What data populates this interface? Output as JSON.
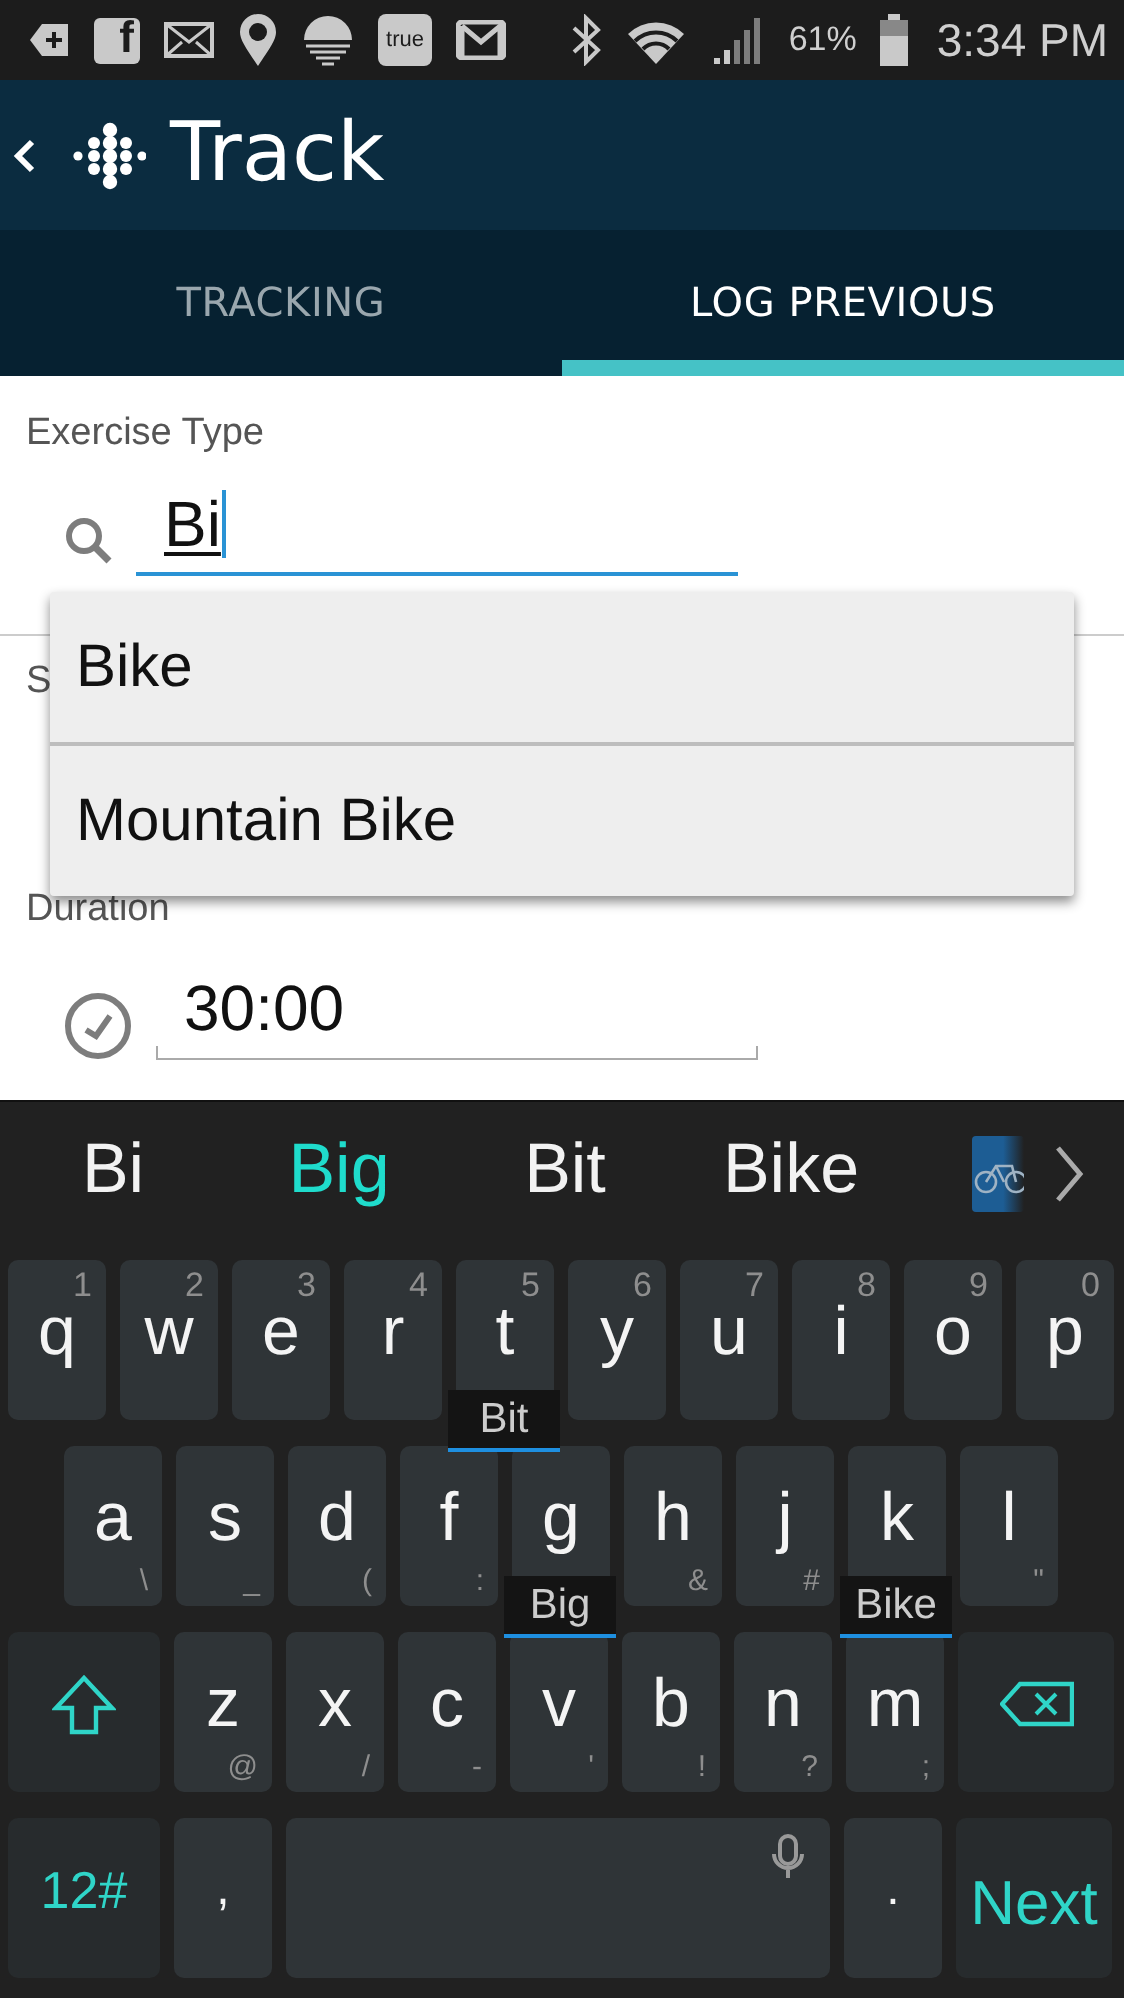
{
  "status_bar": {
    "app_badge": "f",
    "carrier_badge": "true",
    "battery": "61%",
    "time": "3:34 PM"
  },
  "app_bar": {
    "title": "Track"
  },
  "tabs": [
    {
      "label": "TRACKING",
      "selected": false
    },
    {
      "label": "LOG PREVIOUS",
      "selected": true
    }
  ],
  "form": {
    "fields": [
      {
        "kind": "search",
        "label": "Exercise Type",
        "value": "Bi",
        "focused": true
      },
      {
        "kind": "label_only",
        "label": "S"
      },
      {
        "kind": "duration",
        "label": "Duration",
        "value": "30:00",
        "focused": false
      }
    ],
    "dropdown": [
      "Bike",
      "Mountain Bike"
    ]
  },
  "keyboard": {
    "suggestions": [
      {
        "text": "Bi",
        "selected": false
      },
      {
        "text": "Big",
        "selected": true
      },
      {
        "text": "Bit",
        "selected": false
      },
      {
        "text": "Bike",
        "selected": false
      }
    ],
    "rows": [
      {
        "keys": [
          {
            "kind": "letter",
            "label": "q",
            "hint": "1"
          },
          {
            "kind": "letter",
            "label": "w",
            "hint": "2"
          },
          {
            "kind": "letter",
            "label": "e",
            "hint": "3"
          },
          {
            "kind": "letter",
            "label": "r",
            "hint": "4"
          },
          {
            "kind": "letter",
            "label": "t",
            "hint": "5",
            "popup": "Bit"
          },
          {
            "kind": "letter",
            "label": "y",
            "hint": "6"
          },
          {
            "kind": "letter",
            "label": "u",
            "hint": "7"
          },
          {
            "kind": "letter",
            "label": "i",
            "hint": "8"
          },
          {
            "kind": "letter",
            "label": "o",
            "hint": "9"
          },
          {
            "kind": "letter",
            "label": "p",
            "hint": "0"
          }
        ]
      },
      {
        "keys": [
          {
            "kind": "letter",
            "label": "a",
            "hint": "\\"
          },
          {
            "kind": "letter",
            "label": "s",
            "hint": "_"
          },
          {
            "kind": "letter",
            "label": "d",
            "hint": "("
          },
          {
            "kind": "letter",
            "label": "f",
            "hint": ":"
          },
          {
            "kind": "letter",
            "label": "g",
            "popup": "Big"
          },
          {
            "kind": "letter",
            "label": "h",
            "hint": "&"
          },
          {
            "kind": "letter",
            "label": "j",
            "hint": "#"
          },
          {
            "kind": "letter",
            "label": "k",
            "popup": "Bike"
          },
          {
            "kind": "letter",
            "label": "l",
            "hint": "\""
          }
        ]
      },
      {
        "keys": [
          {
            "kind": "shift"
          },
          {
            "kind": "letter",
            "label": "z",
            "hint": "@"
          },
          {
            "kind": "letter",
            "label": "x",
            "hint": "/"
          },
          {
            "kind": "letter",
            "label": "c",
            "hint": "-"
          },
          {
            "kind": "letter",
            "label": "v",
            "hint": "'"
          },
          {
            "kind": "letter",
            "label": "b",
            "hint": "!"
          },
          {
            "kind": "letter",
            "label": "n",
            "hint": "?"
          },
          {
            "kind": "letter",
            "label": "m",
            "hint": ";"
          },
          {
            "kind": "backspace"
          }
        ]
      },
      {
        "keys": [
          {
            "kind": "symbols",
            "label": "12#"
          },
          {
            "kind": "letter",
            "label": ","
          },
          {
            "kind": "space"
          },
          {
            "kind": "letter",
            "label": "."
          },
          {
            "kind": "action",
            "label": "Next"
          }
        ]
      }
    ]
  }
}
